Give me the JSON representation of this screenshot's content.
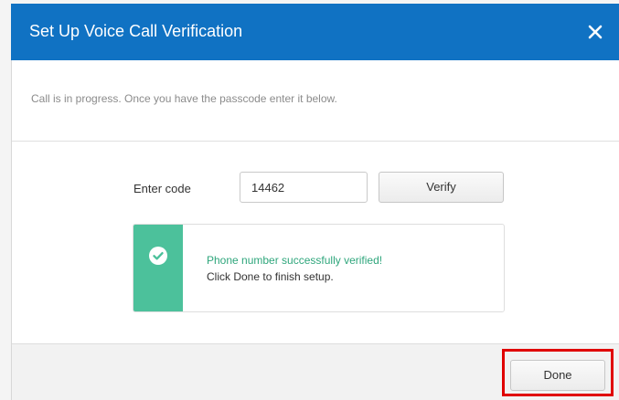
{
  "dialog": {
    "title": "Set Up Voice Call Verification",
    "close_icon": "close-icon"
  },
  "instructions": "Call is in progress. Once you have the passcode enter it below.",
  "code": {
    "label": "Enter code",
    "value": "14462",
    "verify_label": "Verify"
  },
  "success": {
    "icon": "check-circle-icon",
    "title": "Phone number successfully verified!",
    "subtitle": "Click Done to finish setup."
  },
  "footer": {
    "done_label": "Done",
    "highlight": "done-button-highlight"
  },
  "colors": {
    "header_bg": "#1072c3",
    "success_strip": "#4cc19b",
    "success_text": "#2fa67c",
    "highlight_border": "#e00000"
  }
}
